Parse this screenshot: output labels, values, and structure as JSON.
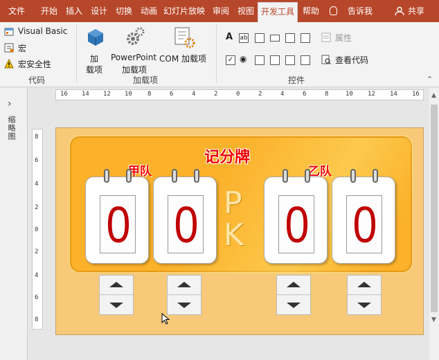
{
  "tabs": [
    "文件",
    "开始",
    "插入",
    "设计",
    "切换",
    "动画",
    "幻灯片放映",
    "审阅",
    "视图",
    "开发工具",
    "帮助"
  ],
  "active_tab": "开发工具",
  "tell_me": "告诉我",
  "share": "共享",
  "ribbon": {
    "code_group": {
      "visual_basic": "Visual Basic",
      "macro": "宏",
      "macro_security": "宏安全性",
      "label": "代码"
    },
    "addins_group": {
      "addins_line1": "加",
      "addins_line2": "载项",
      "powerpoint_line1": "PowerPoint",
      "powerpoint_line2": "加载项",
      "com_addins": "COM 加载项",
      "label": "加载项"
    },
    "controls_group": {
      "properties": "属性",
      "view_code": "查看代码",
      "label": "控件"
    }
  },
  "left_pane": {
    "label": "缩略图"
  },
  "hruler_ticks": [
    "16",
    "14",
    "12",
    "10",
    "8",
    "6",
    "4",
    "2",
    "0",
    "2",
    "4",
    "6",
    "8",
    "10",
    "12",
    "14",
    "16"
  ],
  "vruler_ticks": [
    "8",
    "6",
    "4",
    "2",
    "0",
    "2",
    "4",
    "6",
    "8"
  ],
  "slide": {
    "title": "记分牌",
    "team_a": "甲队",
    "team_b": "乙队",
    "vs": "PK",
    "digits": [
      "0",
      "0",
      "0",
      "0"
    ]
  },
  "colors": {
    "accent": "#b7472a",
    "board": "#fbb12a",
    "digit": "#c00000",
    "slide_bg": "#f7c979"
  }
}
